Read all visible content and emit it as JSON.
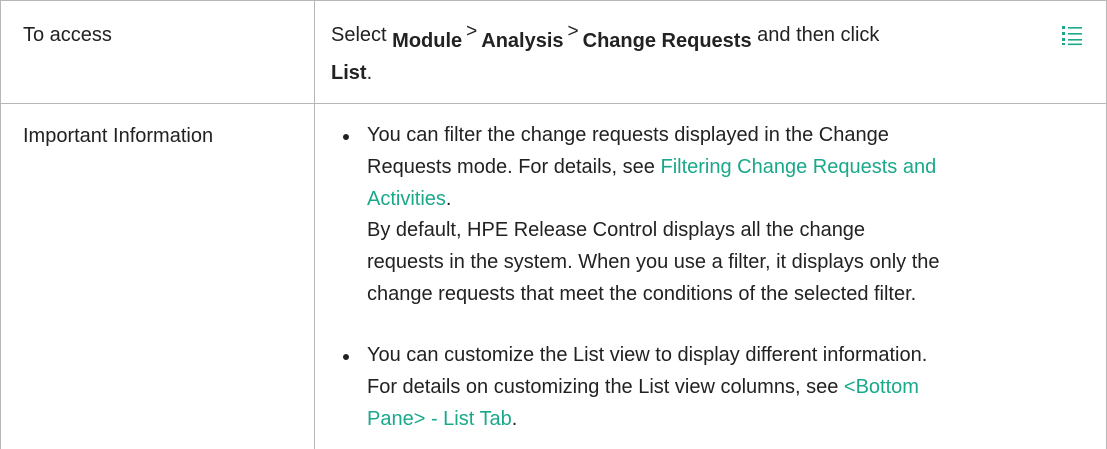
{
  "rows": [
    {
      "label": "To access",
      "access": {
        "pre": "Select",
        "path": [
          "Module",
          "Analysis",
          "Change Requests"
        ],
        "separator": ">",
        "post": "and then click",
        "icon": "list-icon",
        "button": "List",
        "end": "."
      }
    },
    {
      "label": "Important Information",
      "items": [
        {
          "line1": "You can filter the change requests displayed in the Change",
          "line2_pre": "Requests mode. For details, see",
          "link_a": "Filtering Change Requests and",
          "link_b": "Activities",
          "end": ".",
          "extra": [
            "By default, HPE Release Control displays all the change",
            "requests in the system. When you use a filter, it displays only the",
            "change requests that meet the conditions of the selected filter."
          ]
        },
        {
          "line1": "You can customize the List view to display different information.",
          "line2_pre": "For details on customizing the List view columns, see",
          "link_a": "<Bottom",
          "link_b": "Pane> - List Tab",
          "end": "."
        }
      ]
    }
  ],
  "colors": {
    "border": "#b7b7b7",
    "link": "#1aa88a",
    "icon": "#1aa88a"
  }
}
